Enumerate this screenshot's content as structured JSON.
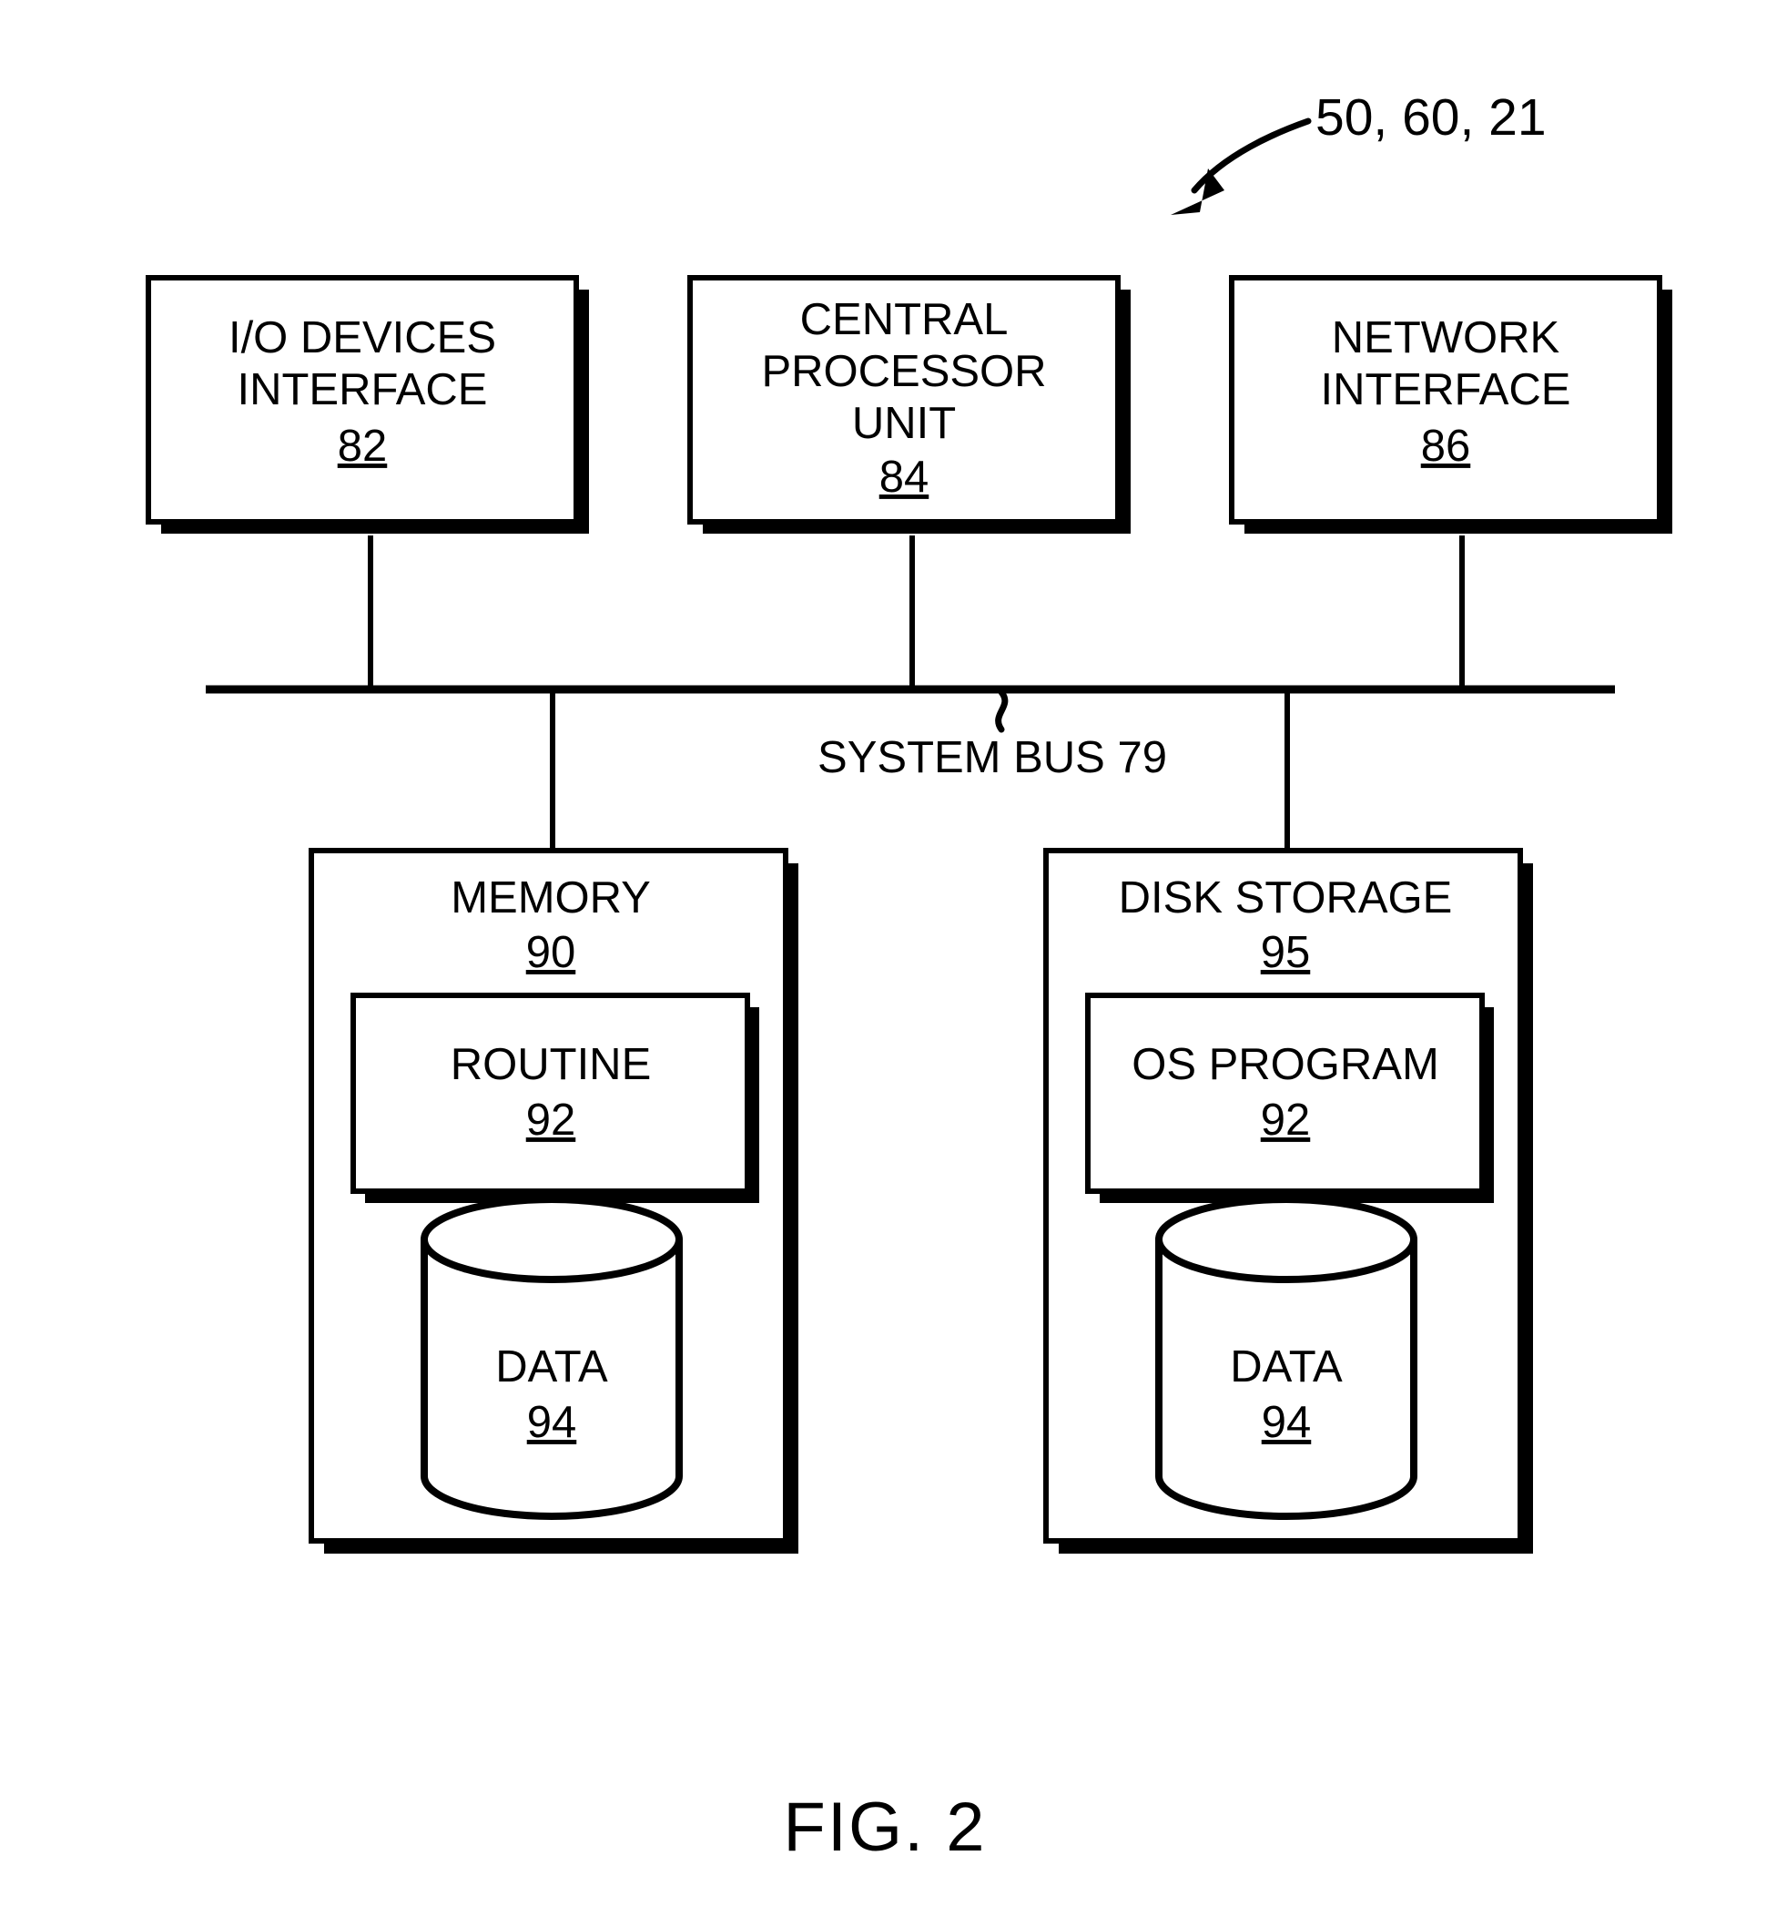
{
  "figure": {
    "caption": "FIG. 2",
    "reference_label": "50, 60, 21",
    "bus_label": "SYSTEM BUS 79"
  },
  "top_blocks": [
    {
      "id": "io-devices-interface",
      "line1": "I/O DEVICES",
      "line2": "INTERFACE",
      "number": "82"
    },
    {
      "id": "central-processor-unit",
      "line1": "CENTRAL",
      "line2": "PROCESSOR",
      "line3": "UNIT",
      "number": "84"
    },
    {
      "id": "network-interface",
      "line1": "NETWORK",
      "line2": "INTERFACE",
      "number": "86"
    }
  ],
  "bottom_blocks": [
    {
      "id": "memory",
      "title": "MEMORY",
      "number": "90",
      "inner_box": {
        "title": "ROUTINE",
        "number": "92"
      },
      "cylinder": {
        "title": "DATA",
        "number": "94"
      }
    },
    {
      "id": "disk-storage",
      "title": "DISK STORAGE",
      "number": "95",
      "inner_box": {
        "title": "OS PROGRAM",
        "number": "92"
      },
      "cylinder": {
        "title": "DATA",
        "number": "94"
      }
    }
  ],
  "colors": {
    "ink": "#000000",
    "paper": "#ffffff"
  }
}
